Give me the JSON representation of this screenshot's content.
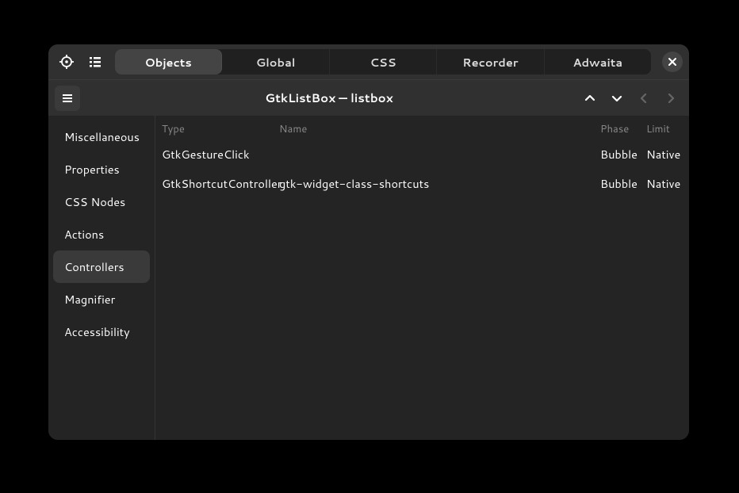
{
  "header": {
    "tabs": [
      {
        "label": "Objects",
        "active": true
      },
      {
        "label": "Global",
        "active": false
      },
      {
        "label": "CSS",
        "active": false
      },
      {
        "label": "Recorder",
        "active": false
      },
      {
        "label": "Adwaita",
        "active": false
      }
    ]
  },
  "subheader": {
    "title": "GtkListBox — listbox"
  },
  "sidebar": {
    "items": [
      {
        "label": "Miscellaneous",
        "selected": false
      },
      {
        "label": "Properties",
        "selected": false
      },
      {
        "label": "CSS Nodes",
        "selected": false
      },
      {
        "label": "Actions",
        "selected": false
      },
      {
        "label": "Controllers",
        "selected": true
      },
      {
        "label": "Magnifier",
        "selected": false
      },
      {
        "label": "Accessibility",
        "selected": false
      }
    ]
  },
  "table": {
    "columns": {
      "type": "Type",
      "name": "Name",
      "phase": "Phase",
      "limit": "Limit"
    },
    "rows": [
      {
        "type": "GtkGestureClick",
        "name": "",
        "phase": "Bubble",
        "limit": "Native"
      },
      {
        "type": "GtkShortcutController",
        "name": "gtk-widget-class-shortcuts",
        "phase": "Bubble",
        "limit": "Native"
      }
    ]
  }
}
